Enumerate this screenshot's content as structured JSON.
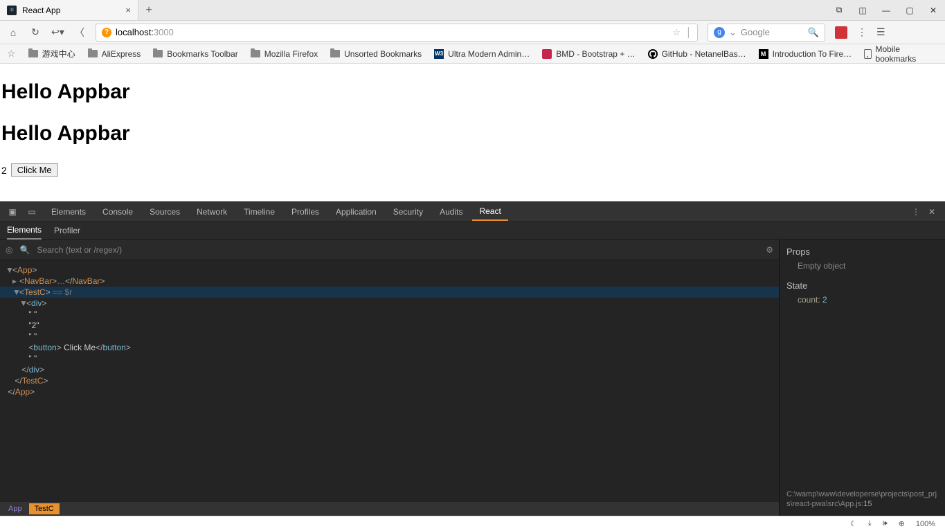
{
  "titlebar": {
    "tab_title": "React App",
    "close_glyph": "×",
    "newtab_glyph": "+"
  },
  "urlbar": {
    "host": "localhost:",
    "port": "3000",
    "search_placeholder": "Google"
  },
  "bookmarks": {
    "items": [
      {
        "label": "游戏中心",
        "type": "folder"
      },
      {
        "label": "AliExpress",
        "type": "folder"
      },
      {
        "label": "Bookmarks Toolbar",
        "type": "folder"
      },
      {
        "label": "Mozilla Firefox",
        "type": "folder"
      },
      {
        "label": "Unsorted Bookmarks",
        "type": "folder"
      },
      {
        "label": "Ultra Modern Admin…",
        "type": "w3"
      },
      {
        "label": "BMD - Bootstrap + …",
        "type": "bmd"
      },
      {
        "label": "GitHub - NetanelBas…",
        "type": "gh"
      },
      {
        "label": "Introduction To Fire…",
        "type": "m"
      }
    ],
    "mobile": "Mobile bookmarks"
  },
  "page": {
    "heading1": "Hello Appbar",
    "heading2": "Hello Appbar",
    "count": "2",
    "button": "Click Me"
  },
  "devtools": {
    "tabs": [
      "Elements",
      "Console",
      "Sources",
      "Network",
      "Timeline",
      "Profiles",
      "Application",
      "Security",
      "Audits",
      "React"
    ],
    "active_tab": "React",
    "subtabs": [
      "Elements",
      "Profiler"
    ],
    "active_sub": "Elements",
    "search_placeholder": "Search (text or /regex/)",
    "tree": {
      "app_open": "<App>",
      "navbar": "<NavBar>…</NavBar>",
      "testc_open": "<TestC>",
      "sel_suffix": " == $r",
      "div_open": "<div>",
      "q1": "\" \"",
      "two": "\"2\"",
      "q2": "\" \"",
      "button_line": "<button> Click Me</button>",
      "q3": "\" \"",
      "div_close": "</div>",
      "testc_close": "</TestC>",
      "app_close": "</App>"
    },
    "breadcrumb": {
      "app": "App",
      "testc": "TestC"
    },
    "props_title": "Props",
    "props_value": "Empty object",
    "state_title": "State",
    "state_key": "count:",
    "state_val": "2",
    "file_path": "C:\\wamp\\www\\developerse\\projects\\post_prjs\\react-pwa\\src\\App.js",
    "file_line": ":15"
  },
  "statusbar": {
    "zoom": "100%"
  }
}
